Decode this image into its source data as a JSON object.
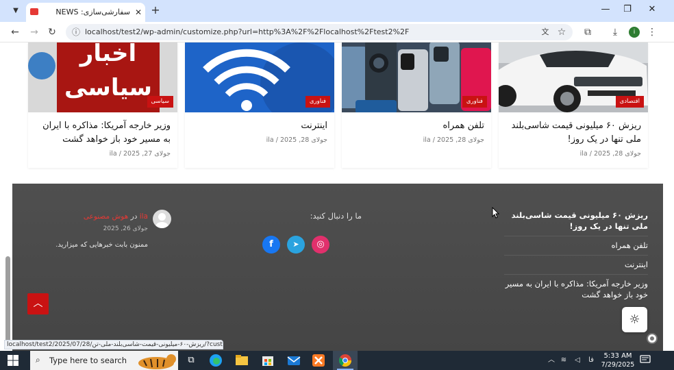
{
  "browser": {
    "tab_title": "سفارشی‌سازی: NEWS",
    "url": "localhost/test2/wp-admin/customize.php?url=http%3A%2F%2Flocalhost%2Ftest2%2F",
    "profile_initial": "i",
    "status_url": "localhost/test2/2025/07/28/ریزش-۶۰-میلیونی-قیمت-شاسی‌بلند-ملی-تن/?custo..."
  },
  "cards": [
    {
      "category": "اقتصادی",
      "title": "ریزش ۶۰ میلیونی قیمت شاسی‌بلند ملی تنها در یک روز!",
      "meta": "جولای 28, 2025 / ila"
    },
    {
      "category": "فناوری",
      "title": "تلفن همراه",
      "meta": "جولای 28, 2025 / ila"
    },
    {
      "category": "فناوری",
      "title": "اینترنت",
      "meta": "جولای 28, 2025 / ila"
    },
    {
      "category": "سیاسی",
      "title": "وزیر خارجه آمریکا: مذاکره با ایران به مسیر خود باز خواهد گشت",
      "meta": "جولای 27, 2025 / ila",
      "image_text_1": "اخبار",
      "image_text_2": "سیاسی"
    }
  ],
  "footer": {
    "recent_posts": [
      "ریزش ۶۰ میلیونی قیمت شاسی‌بلند ملی تنها در یک روز!",
      "تلفن همراه",
      "اینترنت",
      "وزیر خارجه آمریکا: مذاکره با ایران به مسیر خود باز خواهد گشت"
    ],
    "follow_title": "ما را دنبال کنید:",
    "social": {
      "facebook": "f",
      "telegram": "➤",
      "instagram": "◎"
    },
    "comment": {
      "author": "ila",
      "connector": "در",
      "post_link": "هوش مصنوعی",
      "date": "جولای 26, 2025",
      "text": "ممنون بابت خبرهایی که میزارید."
    }
  },
  "taskbar": {
    "search_placeholder": "Type here to search",
    "time": "5:33 AM",
    "date": "7/29/2025",
    "lang": "فا"
  },
  "colors": {
    "accent_red": "#c91212",
    "footer_bg": "#4a4a4a",
    "chrome_tabstrip": "#d3e3fd",
    "facebook": "#1877f2",
    "telegram": "#2aa3df",
    "instagram": "#e1306c"
  },
  "icons": [
    "search-icon",
    "close-icon",
    "back-arrow-icon",
    "forward-arrow-icon",
    "reload-icon",
    "star-icon",
    "extensions-icon",
    "download-icon",
    "menu-icon",
    "chevron-up-icon",
    "sun-icon",
    "windows-icon"
  ]
}
